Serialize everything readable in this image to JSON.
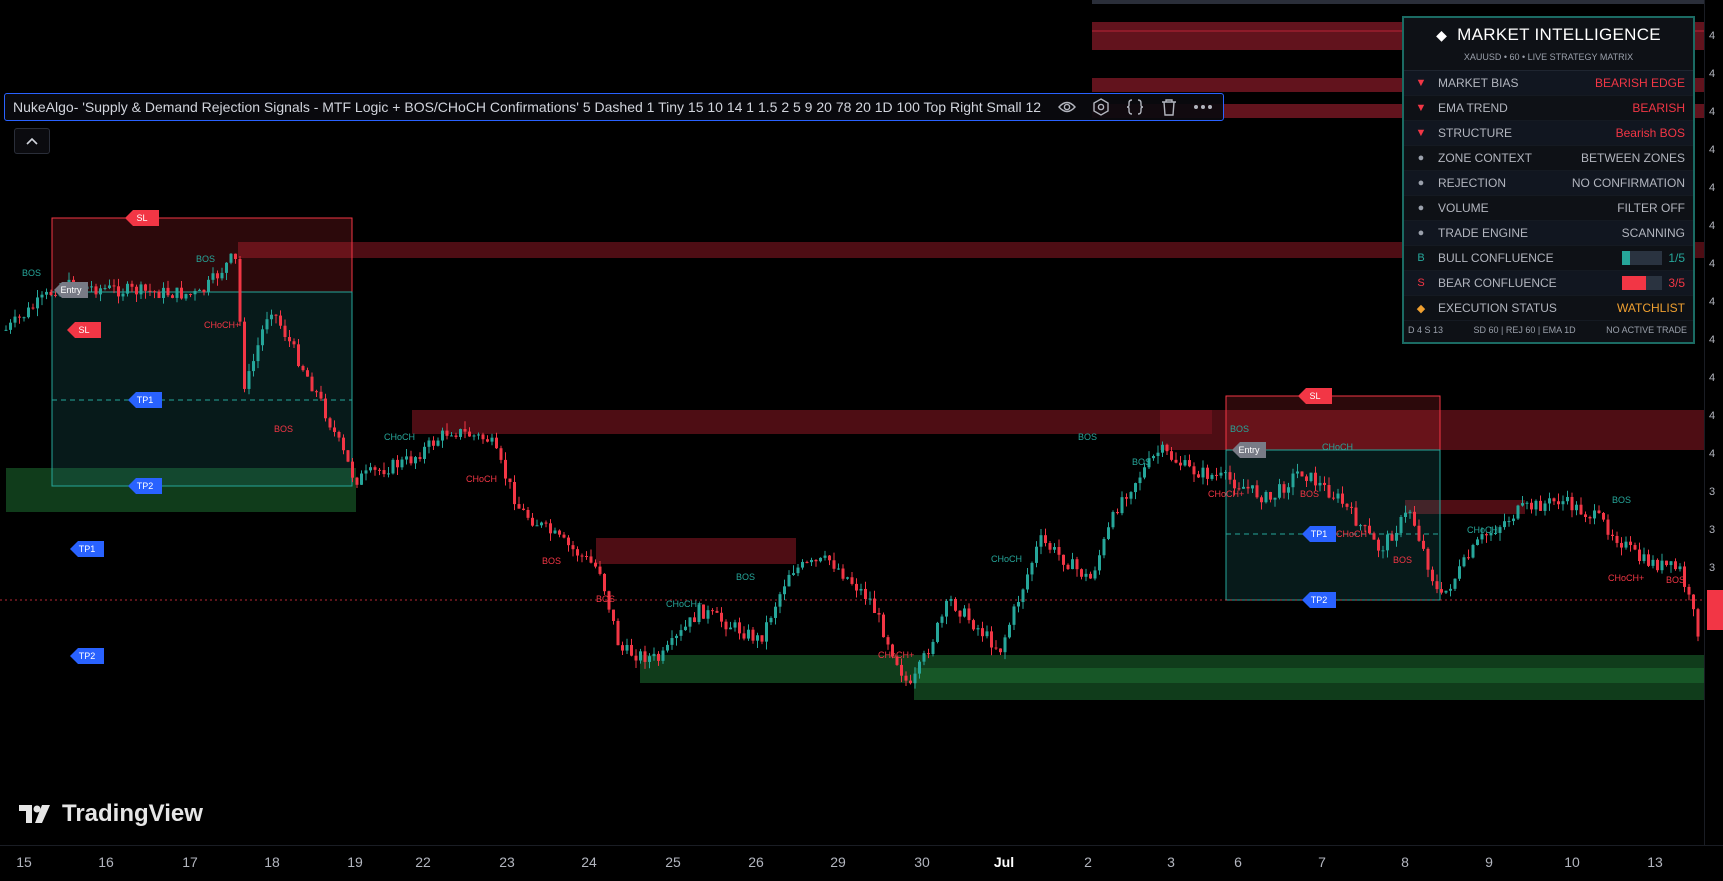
{
  "indicator": {
    "label": "NukeAlgo- 'Supply & Demand Rejection Signals - MTF Logic + BOS/CHoCH Confirmations' 5 Dashed 1 Tiny 15 10 14 1 1.5 2 5 9 20 78 20 1D 100 Top Right Small 12",
    "icons": [
      "eye-icon",
      "settings-icon",
      "source-code-icon",
      "trash-icon",
      "more-icon"
    ]
  },
  "panel": {
    "title": "MARKET INTELLIGENCE",
    "subtitle": "XAUUSD • 60 • LIVE STRATEGY MATRIX",
    "rows": [
      {
        "marker": "▼",
        "label": "MARKET BIAS",
        "value": "BEARISH EDGE",
        "color": "#f23645"
      },
      {
        "marker": "▼",
        "label": "EMA TREND",
        "value": "BEARISH",
        "color": "#f23645"
      },
      {
        "marker": "▼",
        "label": "STRUCTURE",
        "value": "Bearish BOS",
        "color": "#f23645"
      },
      {
        "marker": "●",
        "label": "ZONE CONTEXT",
        "value": "BETWEEN ZONES",
        "color": "#b2b5be"
      },
      {
        "marker": "●",
        "label": "REJECTION",
        "value": "NO CONFIRMATION",
        "color": "#b2b5be"
      },
      {
        "marker": "●",
        "label": "VOLUME",
        "value": "FILTER OFF",
        "color": "#b2b5be"
      },
      {
        "marker": "●",
        "label": "TRADE ENGINE",
        "value": "SCANNING",
        "color": "#b2b5be"
      },
      {
        "marker": "B",
        "label": "BULL CONFLUENCE",
        "value": "1/5",
        "color": "#26a69a",
        "confluence": 0.2
      },
      {
        "marker": "S",
        "label": "BEAR CONFLUENCE",
        "value": "3/5",
        "color": "#f23645",
        "confluence": 0.6
      },
      {
        "marker": "◆",
        "label": "EXECUTION STATUS",
        "value": "WATCHLIST",
        "color": "#f0a030"
      }
    ],
    "footer_left": "D 4   S 13",
    "footer_mid": "SD 60  |  REJ 60  |  EMA 1D",
    "footer_right": "NO ACTIVE TRADE"
  },
  "chart_labels": {
    "sl": "SL",
    "tp1": "TP1",
    "tp2": "TP2",
    "entry": "Entry",
    "bos": "BOS",
    "choch": "CHoCH",
    "chochplus": "CHoCH+"
  },
  "time_axis": [
    "15",
    "16",
    "17",
    "18",
    "19",
    "22",
    "23",
    "24",
    "25",
    "26",
    "29",
    "30",
    "Jul",
    "2",
    "3",
    "6",
    "7",
    "8",
    "9",
    "10",
    "13"
  ],
  "colors": {
    "bull": "#26a69a",
    "bear": "#f23645",
    "accent": "#2962ff",
    "panel_border": "#1b6b63"
  },
  "brand": "TradingView",
  "right_scale": {
    "box": "U",
    "marks": [
      "4",
      "4",
      "4",
      "4",
      "4",
      "4",
      "4",
      "4",
      "4",
      "4",
      "4",
      "4",
      "3",
      "3",
      "3",
      "3"
    ]
  }
}
